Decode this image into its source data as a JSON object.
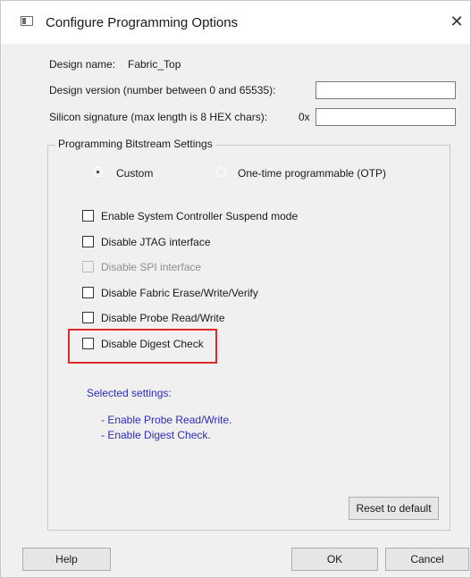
{
  "window": {
    "title": "Configure Programming Options",
    "close_glyph": "✕"
  },
  "design": {
    "name_label": "Design name:",
    "name_value": "Fabric_Top",
    "version_label": "Design version (number between 0 and 65535):",
    "version_value": "",
    "signature_label": "Silicon signature (max length is 8 HEX chars):",
    "signature_prefix": "0x",
    "signature_value": ""
  },
  "bitstream": {
    "group_title": "Programming Bitstream Settings",
    "radio_custom": "Custom",
    "radio_otp": "One-time programmable (OTP)",
    "selected_radio": "Custom",
    "checkboxes": [
      {
        "label": "Enable System Controller Suspend mode",
        "checked": false,
        "enabled": true
      },
      {
        "label": "Disable JTAG interface",
        "checked": false,
        "enabled": true
      },
      {
        "label": "Disable SPI interface",
        "checked": false,
        "enabled": false
      },
      {
        "label": "Disable Fabric Erase/Write/Verify",
        "checked": false,
        "enabled": true
      },
      {
        "label": "Disable Probe Read/Write",
        "checked": false,
        "enabled": true
      },
      {
        "label": "Disable Digest Check",
        "checked": false,
        "enabled": true
      }
    ],
    "selected_title": "Selected settings:",
    "selected_items": [
      "- Enable Probe Read/Write.",
      "- Enable Digest Check."
    ],
    "reset_label": "Reset to default"
  },
  "footer": {
    "help_label": "Help",
    "ok_label": "OK",
    "cancel_label": "Cancel"
  },
  "colors": {
    "highlight": "#e02a2a",
    "info_text": "#2b2bc4"
  }
}
